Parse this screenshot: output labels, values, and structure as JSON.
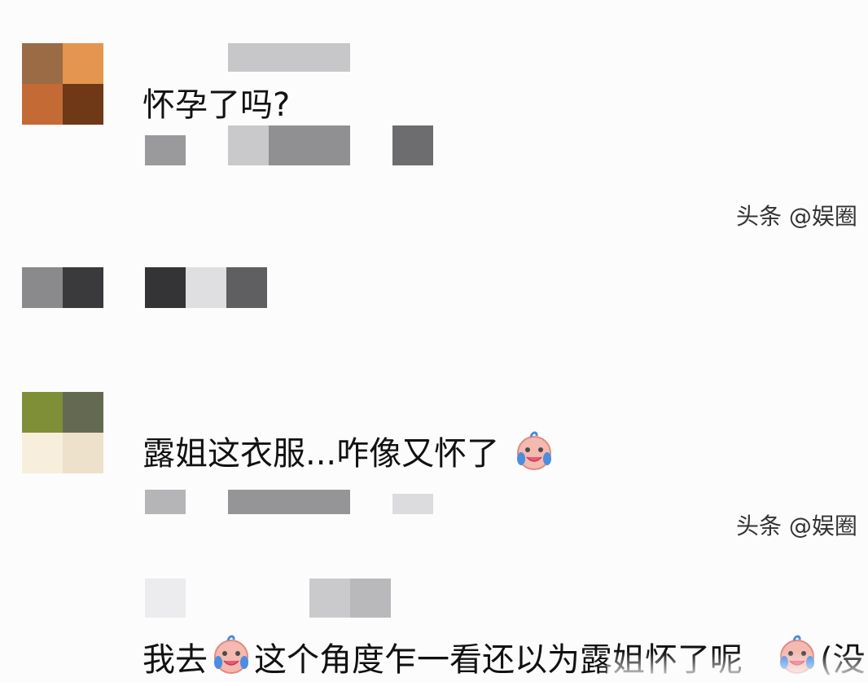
{
  "comments": [
    {
      "text": "怀孕了吗?",
      "avatar_colors": [
        "#9a6b45",
        "#e4954f",
        "#c46a34",
        "#6f3817"
      ]
    },
    {
      "text": "露姐这衣服...咋像又怀了",
      "avatar_colors": [
        "#7f8f37",
        "#646a52",
        "#f7efdc",
        "#eee1cb"
      ]
    },
    {
      "text_part1": "我去",
      "text_part2": "这个角度乍一看还以为露姐怀了呢",
      "text_part3": "(没"
    }
  ],
  "watermarks": [
    "头条 @娱圈",
    "头条 @娱圈"
  ],
  "emoji_name": "crying-laughing-baby-icon",
  "colors": {
    "text": "#111111",
    "watermark": "#333333",
    "background": "#fcfcfd",
    "emoji_face": "#f4b9b0",
    "emoji_tear": "#4b8de0",
    "emoji_accent": "#e75b76"
  }
}
